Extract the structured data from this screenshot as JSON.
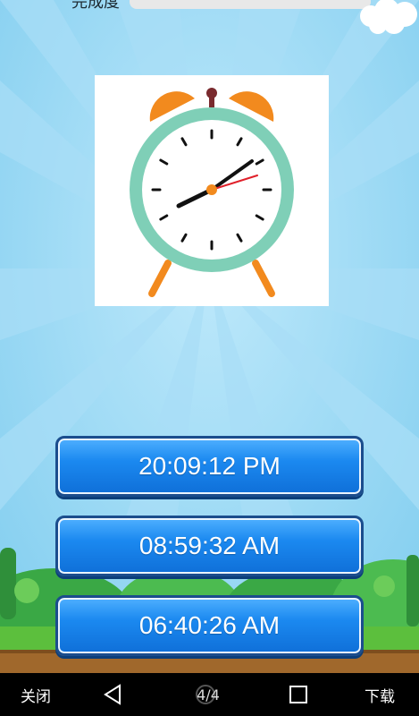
{
  "progress": {
    "label": "完成度",
    "value_fraction": 1.0
  },
  "quiz": {
    "clock_image_alt": "alarm-clock",
    "options": [
      "20:09:12 PM",
      "08:59:32 AM",
      "06:40:26 AM"
    ]
  },
  "navbar": {
    "close_label": "关闭",
    "page_indicator": "4/4",
    "download_label": "下载"
  },
  "colors": {
    "sky": "#8fd3f0",
    "button_blue": "#1b89f0",
    "clock_ring": "#7fcfb7",
    "bell_orange": "#f28a1e",
    "second_hand": "#e0202a"
  },
  "icons": {
    "back": "triangle-back-icon",
    "home": "circle-home-icon",
    "recent": "square-recent-icon"
  }
}
